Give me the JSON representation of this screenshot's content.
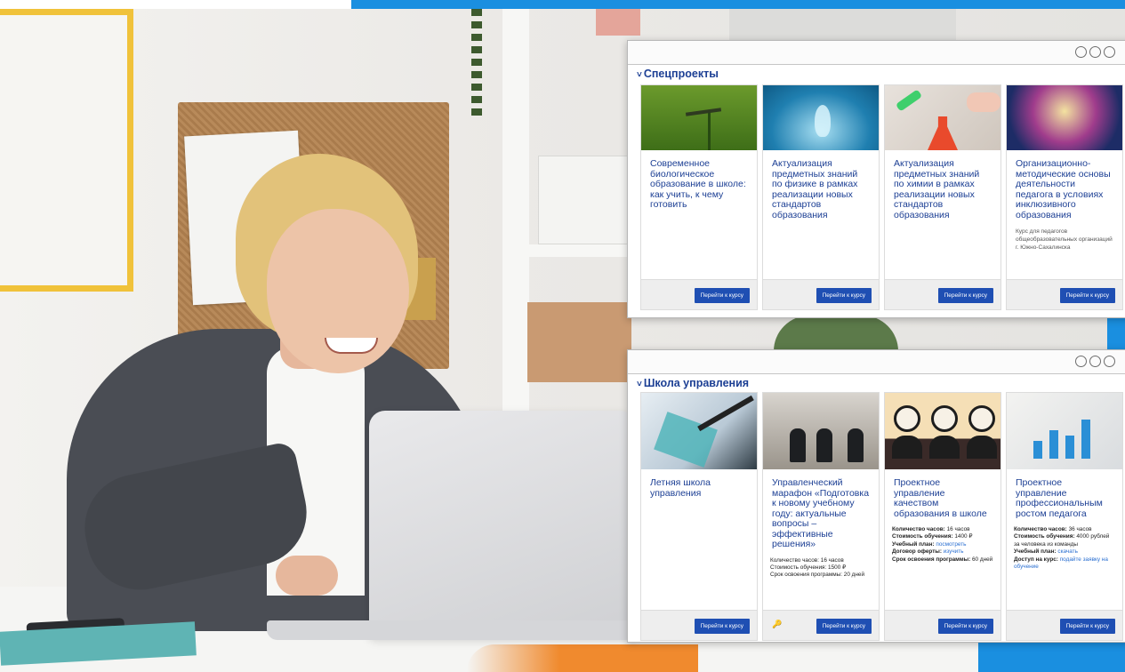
{
  "panels": [
    {
      "section_title": "Спецпроекты",
      "cards": [
        {
          "title": "Современное биологическое образование в школе: как учить, к чему готовить",
          "description": "",
          "button": "Перейти к курсу"
        },
        {
          "title": "Актуализация предметных знаний по физике в рамках реализации новых стандартов образования",
          "description": "",
          "button": "Перейти к курсу"
        },
        {
          "title": "Актуализация предметных знаний по химии в рамках реализации новых стандартов образования",
          "description": "",
          "button": "Перейти к курсу"
        },
        {
          "title": "Организационно-методические основы деятельности педагога в условиях инклюзивного образования",
          "description": "Курс для педагогов общеобразовательных организаций г. Южно-Сахалинска",
          "button": "Перейти к курсу"
        }
      ]
    },
    {
      "section_title": "Школа управления",
      "cards": [
        {
          "title": "Летняя школа управления",
          "button": "Перейти к курсу"
        },
        {
          "title": "Управленческий марафон «Подготовка к новому учебному году: актуальные вопросы – эффективные решения»",
          "meta": [
            {
              "label": "Количество часов:",
              "value": "16 часов"
            },
            {
              "label": "Стоимость обучения:",
              "value": "1500 ₽"
            },
            {
              "label": "Срок освоения программы:",
              "value": "20 дней"
            }
          ],
          "button": "Перейти к курсу"
        },
        {
          "title": "Проектное управление качеством образования в школе",
          "meta": [
            {
              "label": "Количество часов:",
              "value": "16 часов"
            },
            {
              "label": "Стоимость обучения:",
              "value": "1400 ₽"
            },
            {
              "label": "Учебный план:",
              "link": "посмотреть"
            },
            {
              "label": "Договор оферты:",
              "link": "изучить"
            },
            {
              "label": "Срок освоения программы:",
              "value": "60 дней"
            }
          ],
          "button": "Перейти к курсу"
        },
        {
          "title": "Проектное управление профессиональным ростом педагога",
          "meta": [
            {
              "label": "Количество часов:",
              "value": "36 часов"
            },
            {
              "label": "Стоимость обучения:",
              "value": "4000 рублей за человека из команды"
            },
            {
              "label": "Учебный план:",
              "link": "скачать"
            },
            {
              "label": "Доступ на курс:",
              "link": "подайте заявку на обучение"
            }
          ],
          "button": "Перейти к курсу"
        }
      ]
    }
  ],
  "icons": {
    "window_controls": "three-circle-icons",
    "key": "key-icon"
  },
  "colors": {
    "accent_blue": "#1a8fe0",
    "title_blue": "#1c3f94",
    "button_blue": "#1f4fb3",
    "orange": "#f08a2e"
  }
}
